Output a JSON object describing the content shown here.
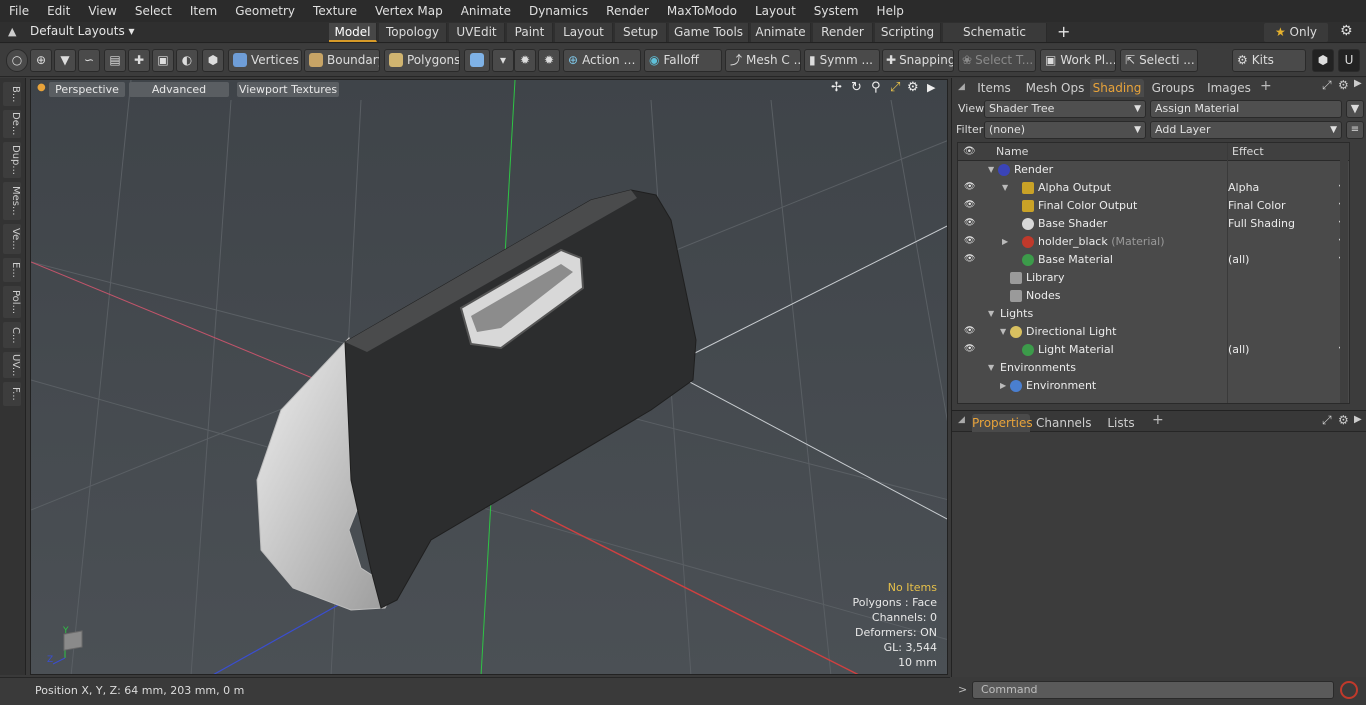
{
  "menu": [
    "File",
    "Edit",
    "View",
    "Select",
    "Item",
    "Geometry",
    "Texture",
    "Vertex Map",
    "Animate",
    "Dynamics",
    "Render",
    "MaxToModo",
    "Layout",
    "System",
    "Help"
  ],
  "layouts": {
    "label": "Default Layouts"
  },
  "tabs": [
    "Model",
    "Topology",
    "UVEdit",
    "Paint",
    "Layout",
    "Setup",
    "Game Tools",
    "Animate",
    "Render",
    "Scripting",
    "Schematic Fusion"
  ],
  "tabs_active": "Model",
  "only_label": "Only",
  "toolbar": {
    "vertices": "Vertices",
    "boundary": "Boundary",
    "polygons": "Polygons",
    "action": "Action",
    "falloff": "Falloff",
    "mesh": "Mesh C ...",
    "symm": "Symm ...",
    "snapping": "Snapping",
    "select_t": "Select T...",
    "work_pl": "Work Pl...",
    "selecti": "Selecti ...",
    "kits": "Kits"
  },
  "left_strip": [
    "B...",
    "De...",
    "Dup...",
    "Mes...",
    "Ve...",
    "E...",
    "Pol...",
    "C...",
    "UV...",
    "F..."
  ],
  "viewport": {
    "perspective": "Perspective",
    "advanced": "Advanced",
    "viewport_textures": "Viewport Textures",
    "info": {
      "items": "No Items",
      "polygons": "Polygons : Face",
      "channels": "Channels: 0",
      "deformers": "Deformers: ON",
      "gl": "GL: 3,544",
      "scale": "10 mm"
    }
  },
  "status": {
    "position": "Position X, Y, Z:   64 mm, 203 mm, 0 m"
  },
  "right_tabs": [
    "Items",
    "Mesh Ops",
    "Shading",
    "Groups",
    "Images"
  ],
  "right_tabs_active": "Shading",
  "shader": {
    "view_label": "View",
    "view_value": "Shader Tree",
    "assign_material": "Assign Material",
    "filter_label": "Filter",
    "filter_value": "(none)",
    "add_layer": "Add Layer",
    "col_name": "Name",
    "col_effect": "Effect",
    "rows": [
      {
        "name": "Render",
        "effect": "",
        "indent": 0,
        "eye": false,
        "icon": "render"
      },
      {
        "name": "Alpha Output",
        "effect": "Alpha",
        "indent": 2,
        "eye": true,
        "icon": "output"
      },
      {
        "name": "Final Color Output",
        "effect": "Final Color",
        "indent": 2,
        "eye": true,
        "icon": "output"
      },
      {
        "name": "Base Shader",
        "effect": "Full Shading",
        "indent": 2,
        "eye": true,
        "icon": "shader"
      },
      {
        "name": "holder_black",
        "sub": "(Material)",
        "effect": "",
        "indent": 2,
        "eye": true,
        "icon": "material-red"
      },
      {
        "name": "Base Material",
        "effect": "(all)",
        "indent": 2,
        "eye": true,
        "icon": "material-green"
      },
      {
        "name": "Library",
        "effect": "",
        "indent": 1,
        "eye": false,
        "icon": "folder"
      },
      {
        "name": "Nodes",
        "effect": "",
        "indent": 1,
        "eye": false,
        "icon": "folder"
      },
      {
        "name": "Lights",
        "effect": "",
        "indent": 0,
        "eye": false,
        "icon": ""
      },
      {
        "name": "Directional Light",
        "effect": "",
        "indent": 1,
        "eye": true,
        "icon": "light"
      },
      {
        "name": "Light Material",
        "effect": "(all)",
        "indent": 2,
        "eye": true,
        "icon": "material-green"
      },
      {
        "name": "Environments",
        "effect": "",
        "indent": 0,
        "eye": false,
        "icon": ""
      },
      {
        "name": "Environment",
        "effect": "",
        "indent": 1,
        "eye": false,
        "icon": "environment"
      }
    ]
  },
  "bottom_tabs": [
    "Properties",
    "Channels",
    "Lists"
  ],
  "bottom_tabs_active": "Properties",
  "command": {
    "placeholder": "Command"
  }
}
